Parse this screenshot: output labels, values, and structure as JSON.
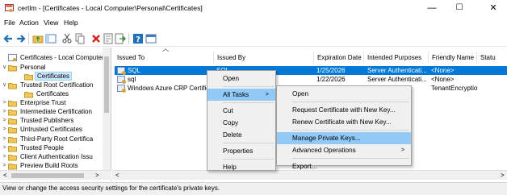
{
  "window": {
    "title": "certlm - [Certificates - Local Computer\\Personal\\Certificates]",
    "minimize": "—",
    "maximize": "☐",
    "close": "✕"
  },
  "menu": [
    "File",
    "Action",
    "View",
    "Help"
  ],
  "toolbar_icons": [
    "back-icon",
    "forward-icon",
    "up-folder-icon",
    "show-hide-tree-icon",
    "cut-icon",
    "copy-icon",
    "delete-icon",
    "properties-icon",
    "export-icon",
    "help-icon",
    "console-icon"
  ],
  "tree": [
    {
      "label": "Certificates - Local Computer",
      "level": 0,
      "twisty": ""
    },
    {
      "label": "Personal",
      "level": 1,
      "twisty": "∨"
    },
    {
      "label": "Certificates",
      "level": 2,
      "twisty": "",
      "selected": true
    },
    {
      "label": "Trusted Root Certification",
      "level": 1,
      "twisty": "∨"
    },
    {
      "label": "Certificates",
      "level": 2,
      "twisty": ""
    },
    {
      "label": "Enterprise Trust",
      "level": 1,
      "twisty": ">"
    },
    {
      "label": "Intermediate Certification",
      "level": 1,
      "twisty": ">"
    },
    {
      "label": "Trusted Publishers",
      "level": 1,
      "twisty": ">"
    },
    {
      "label": "Untrusted Certificates",
      "level": 1,
      "twisty": ">"
    },
    {
      "label": "Third-Party Root Certifica",
      "level": 1,
      "twisty": ">"
    },
    {
      "label": "Trusted People",
      "level": 1,
      "twisty": ">"
    },
    {
      "label": "Client Authentication Issu",
      "level": 1,
      "twisty": ">"
    },
    {
      "label": "Preview Build Roots",
      "level": 1,
      "twisty": ">"
    }
  ],
  "columns": [
    "Issued To",
    "Issued By",
    "Expiration Date",
    "Intended Purposes",
    "Friendly Name",
    "Statu"
  ],
  "rows": [
    {
      "issued_to": "SQL",
      "issued_by": "SQL",
      "expiration": "1/25/2026",
      "purposes": "Server Authenticati...",
      "friendly": "<None>",
      "selected": true
    },
    {
      "issued_to": "sql",
      "issued_by": "",
      "expiration": "1/22/2026",
      "purposes": "Server Authenticati...",
      "friendly": "<None>",
      "selected": false
    },
    {
      "issued_to": "Windows Azure CRP Certificate",
      "issued_by": "",
      "expiration": "",
      "purposes": "",
      "friendly": "TenantEncryptionC...",
      "selected": false
    }
  ],
  "context_menu": {
    "items": [
      "Open",
      "All Tasks",
      "Cut",
      "Copy",
      "Delete",
      "Properties",
      "Help"
    ],
    "all_tasks_arrow": ">"
  },
  "submenu": {
    "items": [
      "Open",
      "Request Certificate with New Key...",
      "Renew Certificate with New Key...",
      "Manage Private Keys...",
      "Advanced Operations",
      "Export..."
    ],
    "advanced_arrow": ">"
  },
  "scroll": {
    "left": "<",
    "right": ">"
  },
  "status": "View or change the access security settings for the certificate's private keys.",
  "colors": {
    "selection": "#0078d7",
    "menu_highlight": "#91c9f7"
  }
}
